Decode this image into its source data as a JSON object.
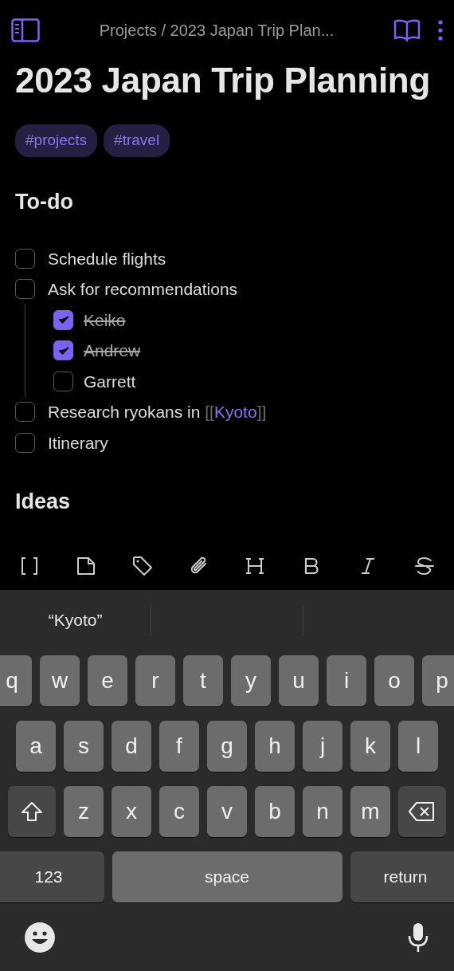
{
  "header": {
    "breadcrumb": "Projects / 2023 Japan Trip Plan..."
  },
  "title": "2023 Japan Trip Planning",
  "tags": [
    "#projects",
    "#travel"
  ],
  "sections": [
    {
      "heading": "To-do",
      "todos": [
        {
          "text": "Schedule flights",
          "checked": false
        },
        {
          "text": "Ask for recommendations",
          "checked": false,
          "children": [
            {
              "text": "Keiko",
              "checked": true
            },
            {
              "text": "Andrew",
              "checked": true
            },
            {
              "text": "Garrett",
              "checked": false
            }
          ]
        },
        {
          "text": "Research ryokans in ",
          "checked": false,
          "link": {
            "open": "[[",
            "label": "Kyoto",
            "close": "]]"
          }
        },
        {
          "text": "Itinerary",
          "checked": false
        }
      ]
    },
    {
      "heading": "Ideas"
    }
  ],
  "toolbar": [
    {
      "kind": "link"
    },
    {
      "kind": "file"
    },
    {
      "kind": "tag"
    },
    {
      "kind": "attach"
    },
    {
      "kind": "heading"
    },
    {
      "kind": "bold"
    },
    {
      "kind": "italic"
    },
    {
      "kind": "strike"
    }
  ],
  "keyboard": {
    "suggestions": [
      "“Kyoto”"
    ],
    "rows": [
      {
        "keys": [
          {
            "kind": "letter",
            "label": "q"
          },
          {
            "kind": "letter",
            "label": "w"
          },
          {
            "kind": "letter",
            "label": "e"
          },
          {
            "kind": "letter",
            "label": "r"
          },
          {
            "kind": "letter",
            "label": "t"
          },
          {
            "kind": "letter",
            "label": "y"
          },
          {
            "kind": "letter",
            "label": "u"
          },
          {
            "kind": "letter",
            "label": "i"
          },
          {
            "kind": "letter",
            "label": "o"
          },
          {
            "kind": "letter",
            "label": "p"
          }
        ]
      },
      {
        "keys": [
          {
            "kind": "letter",
            "label": "a"
          },
          {
            "kind": "letter",
            "label": "s"
          },
          {
            "kind": "letter",
            "label": "d"
          },
          {
            "kind": "letter",
            "label": "f"
          },
          {
            "kind": "letter",
            "label": "g"
          },
          {
            "kind": "letter",
            "label": "h"
          },
          {
            "kind": "letter",
            "label": "j"
          },
          {
            "kind": "letter",
            "label": "k"
          },
          {
            "kind": "letter",
            "label": "l"
          }
        ]
      },
      {
        "keys": [
          {
            "kind": "shift"
          },
          {
            "kind": "letter",
            "label": "z"
          },
          {
            "kind": "letter",
            "label": "x"
          },
          {
            "kind": "letter",
            "label": "c"
          },
          {
            "kind": "letter",
            "label": "v"
          },
          {
            "kind": "letter",
            "label": "b"
          },
          {
            "kind": "letter",
            "label": "n"
          },
          {
            "kind": "letter",
            "label": "m"
          },
          {
            "kind": "delete"
          }
        ]
      },
      {
        "keys": [
          {
            "kind": "numbers",
            "label": "123"
          },
          {
            "kind": "space",
            "label": "space"
          },
          {
            "kind": "return",
            "label": "return"
          }
        ]
      }
    ]
  }
}
